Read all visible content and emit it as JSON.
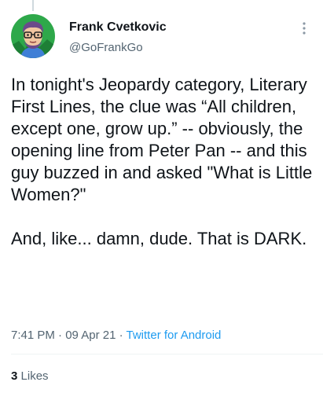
{
  "author": {
    "name": "Frank Cvetkovic",
    "handle": "@GoFrankGo"
  },
  "tweet": {
    "text": "In tonight's Jeopardy category, Literary First Lines, the clue was “All children, except one, grow up.” -- obviously, the opening line from Peter Pan -- and this guy buzzed in and asked \"What is Little Women?\"\n\nAnd, like... damn, dude. That is DARK."
  },
  "meta": {
    "time": "7:41 PM",
    "separator": "·",
    "date": "09 Apr 21",
    "source": "Twitter for Android"
  },
  "stats": {
    "likes_count": "3",
    "likes_label": "Likes"
  },
  "icons": {
    "more": "more-vertical-icon"
  },
  "colors": {
    "text": "#0f1419",
    "secondary": "#536471",
    "link": "#1d9bf0",
    "avatar_bg": "#2ea84a",
    "avatar_hair": "#6b4a8a"
  }
}
